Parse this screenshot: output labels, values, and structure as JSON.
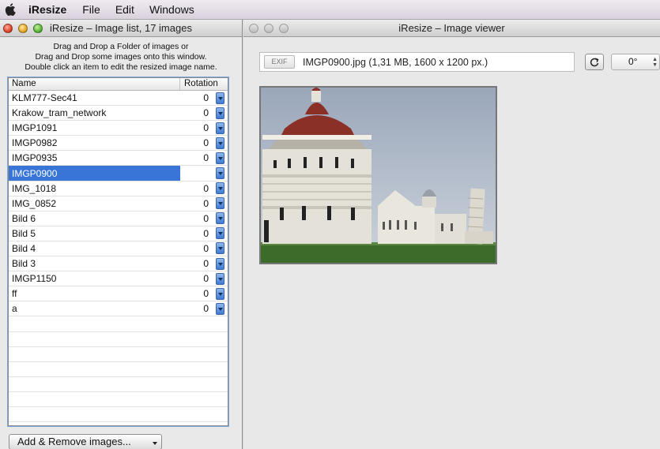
{
  "menubar": {
    "app_name": "iResize",
    "items": [
      "File",
      "Edit",
      "Windows"
    ]
  },
  "list_window": {
    "title": "iResize – Image list, 17 images",
    "instructions": [
      "Drag and Drop a Folder of images or",
      "Drag and Drop some images onto this window.",
      "Double click an item to edit the resized image name."
    ],
    "columns": {
      "name": "Name",
      "rotation": "Rotation"
    },
    "rows": [
      {
        "name": "KLM777-Sec41",
        "rotation": "0"
      },
      {
        "name": "Krakow_tram_network",
        "rotation": "0"
      },
      {
        "name": "IMGP1091",
        "rotation": "0"
      },
      {
        "name": "IMGP0982",
        "rotation": "0"
      },
      {
        "name": "IMGP0935",
        "rotation": "0"
      },
      {
        "name": "IMGP0900",
        "rotation": ""
      },
      {
        "name": "IMG_1018",
        "rotation": "0"
      },
      {
        "name": "IMG_0852",
        "rotation": "0"
      },
      {
        "name": "Bild 6",
        "rotation": "0"
      },
      {
        "name": "Bild 5",
        "rotation": "0"
      },
      {
        "name": "Bild 4",
        "rotation": "0"
      },
      {
        "name": "Bild 3",
        "rotation": "0"
      },
      {
        "name": "IMGP1150",
        "rotation": "0"
      },
      {
        "name": "ff",
        "rotation": "0"
      },
      {
        "name": "a",
        "rotation": "0"
      }
    ],
    "selected_row": "IMGP0900",
    "add_remove_button": "Add & Remove images..."
  },
  "viewer_window": {
    "title": "iResize – Image viewer",
    "exif_label": "EXIF",
    "image_info": "IMGP0900.jpg  (1,31 MB, 1600 x 1200 px.)",
    "rotation_value": "0°",
    "photo_icon": "pisa-cathedral-photo"
  },
  "colors": {
    "selection": "#3875d7",
    "stepper": "#3e7ad3"
  }
}
